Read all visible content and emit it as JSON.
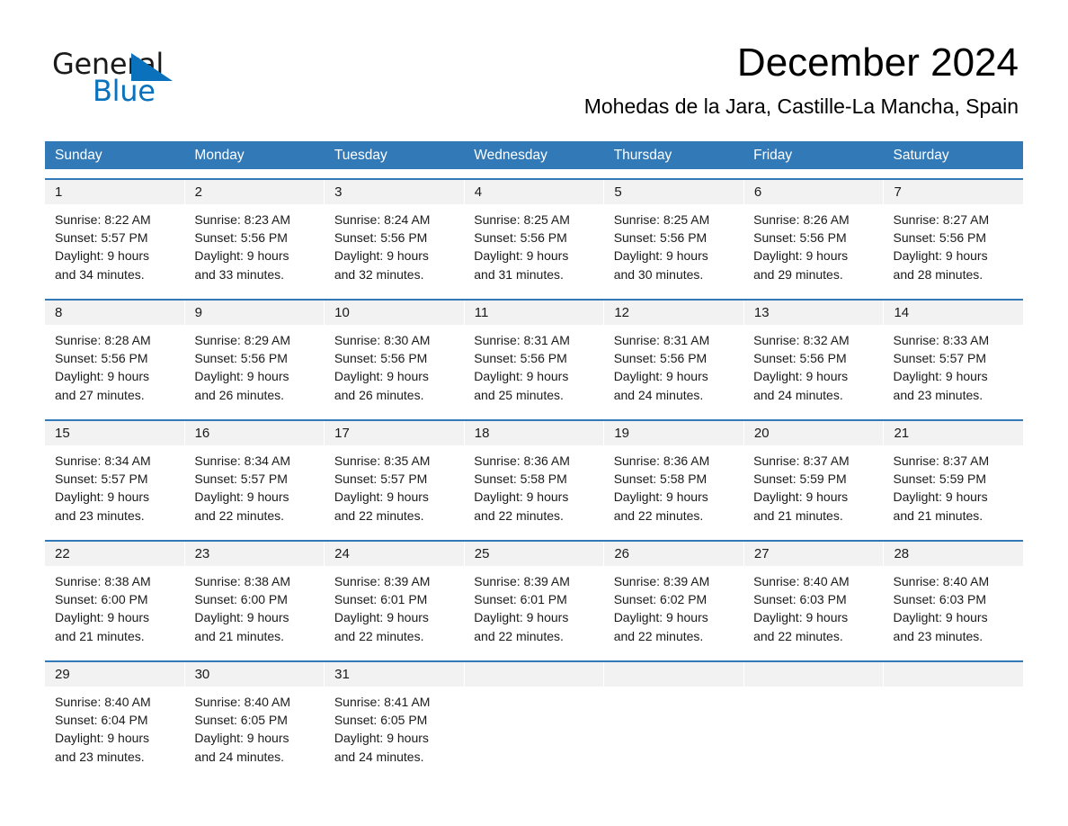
{
  "logo": {
    "word1": "General",
    "word2": "Blue",
    "triangle_color": "#0a72bd",
    "text_color": "#1a1a1a"
  },
  "header": {
    "title": "December 2024",
    "subtitle": "Mohedas de la Jara, Castille-La Mancha, Spain"
  },
  "theme": {
    "header_blue": "#3279b7",
    "daynum_gray": "#f2f2f2",
    "text": "#1a1a1a"
  },
  "weekdays": [
    "Sunday",
    "Monday",
    "Tuesday",
    "Wednesday",
    "Thursday",
    "Friday",
    "Saturday"
  ],
  "weeks": [
    {
      "daynums": [
        "1",
        "2",
        "3",
        "4",
        "5",
        "6",
        "7"
      ],
      "cells": [
        {
          "sunrise": "Sunrise: 8:22 AM",
          "sunset": "Sunset: 5:57 PM",
          "daylight1": "Daylight: 9 hours",
          "daylight2": "and 34 minutes."
        },
        {
          "sunrise": "Sunrise: 8:23 AM",
          "sunset": "Sunset: 5:56 PM",
          "daylight1": "Daylight: 9 hours",
          "daylight2": "and 33 minutes."
        },
        {
          "sunrise": "Sunrise: 8:24 AM",
          "sunset": "Sunset: 5:56 PM",
          "daylight1": "Daylight: 9 hours",
          "daylight2": "and 32 minutes."
        },
        {
          "sunrise": "Sunrise: 8:25 AM",
          "sunset": "Sunset: 5:56 PM",
          "daylight1": "Daylight: 9 hours",
          "daylight2": "and 31 minutes."
        },
        {
          "sunrise": "Sunrise: 8:25 AM",
          "sunset": "Sunset: 5:56 PM",
          "daylight1": "Daylight: 9 hours",
          "daylight2": "and 30 minutes."
        },
        {
          "sunrise": "Sunrise: 8:26 AM",
          "sunset": "Sunset: 5:56 PM",
          "daylight1": "Daylight: 9 hours",
          "daylight2": "and 29 minutes."
        },
        {
          "sunrise": "Sunrise: 8:27 AM",
          "sunset": "Sunset: 5:56 PM",
          "daylight1": "Daylight: 9 hours",
          "daylight2": "and 28 minutes."
        }
      ]
    },
    {
      "daynums": [
        "8",
        "9",
        "10",
        "11",
        "12",
        "13",
        "14"
      ],
      "cells": [
        {
          "sunrise": "Sunrise: 8:28 AM",
          "sunset": "Sunset: 5:56 PM",
          "daylight1": "Daylight: 9 hours",
          "daylight2": "and 27 minutes."
        },
        {
          "sunrise": "Sunrise: 8:29 AM",
          "sunset": "Sunset: 5:56 PM",
          "daylight1": "Daylight: 9 hours",
          "daylight2": "and 26 minutes."
        },
        {
          "sunrise": "Sunrise: 8:30 AM",
          "sunset": "Sunset: 5:56 PM",
          "daylight1": "Daylight: 9 hours",
          "daylight2": "and 26 minutes."
        },
        {
          "sunrise": "Sunrise: 8:31 AM",
          "sunset": "Sunset: 5:56 PM",
          "daylight1": "Daylight: 9 hours",
          "daylight2": "and 25 minutes."
        },
        {
          "sunrise": "Sunrise: 8:31 AM",
          "sunset": "Sunset: 5:56 PM",
          "daylight1": "Daylight: 9 hours",
          "daylight2": "and 24 minutes."
        },
        {
          "sunrise": "Sunrise: 8:32 AM",
          "sunset": "Sunset: 5:56 PM",
          "daylight1": "Daylight: 9 hours",
          "daylight2": "and 24 minutes."
        },
        {
          "sunrise": "Sunrise: 8:33 AM",
          "sunset": "Sunset: 5:57 PM",
          "daylight1": "Daylight: 9 hours",
          "daylight2": "and 23 minutes."
        }
      ]
    },
    {
      "daynums": [
        "15",
        "16",
        "17",
        "18",
        "19",
        "20",
        "21"
      ],
      "cells": [
        {
          "sunrise": "Sunrise: 8:34 AM",
          "sunset": "Sunset: 5:57 PM",
          "daylight1": "Daylight: 9 hours",
          "daylight2": "and 23 minutes."
        },
        {
          "sunrise": "Sunrise: 8:34 AM",
          "sunset": "Sunset: 5:57 PM",
          "daylight1": "Daylight: 9 hours",
          "daylight2": "and 22 minutes."
        },
        {
          "sunrise": "Sunrise: 8:35 AM",
          "sunset": "Sunset: 5:57 PM",
          "daylight1": "Daylight: 9 hours",
          "daylight2": "and 22 minutes."
        },
        {
          "sunrise": "Sunrise: 8:36 AM",
          "sunset": "Sunset: 5:58 PM",
          "daylight1": "Daylight: 9 hours",
          "daylight2": "and 22 minutes."
        },
        {
          "sunrise": "Sunrise: 8:36 AM",
          "sunset": "Sunset: 5:58 PM",
          "daylight1": "Daylight: 9 hours",
          "daylight2": "and 22 minutes."
        },
        {
          "sunrise": "Sunrise: 8:37 AM",
          "sunset": "Sunset: 5:59 PM",
          "daylight1": "Daylight: 9 hours",
          "daylight2": "and 21 minutes."
        },
        {
          "sunrise": "Sunrise: 8:37 AM",
          "sunset": "Sunset: 5:59 PM",
          "daylight1": "Daylight: 9 hours",
          "daylight2": "and 21 minutes."
        }
      ]
    },
    {
      "daynums": [
        "22",
        "23",
        "24",
        "25",
        "26",
        "27",
        "28"
      ],
      "cells": [
        {
          "sunrise": "Sunrise: 8:38 AM",
          "sunset": "Sunset: 6:00 PM",
          "daylight1": "Daylight: 9 hours",
          "daylight2": "and 21 minutes."
        },
        {
          "sunrise": "Sunrise: 8:38 AM",
          "sunset": "Sunset: 6:00 PM",
          "daylight1": "Daylight: 9 hours",
          "daylight2": "and 21 minutes."
        },
        {
          "sunrise": "Sunrise: 8:39 AM",
          "sunset": "Sunset: 6:01 PM",
          "daylight1": "Daylight: 9 hours",
          "daylight2": "and 22 minutes."
        },
        {
          "sunrise": "Sunrise: 8:39 AM",
          "sunset": "Sunset: 6:01 PM",
          "daylight1": "Daylight: 9 hours",
          "daylight2": "and 22 minutes."
        },
        {
          "sunrise": "Sunrise: 8:39 AM",
          "sunset": "Sunset: 6:02 PM",
          "daylight1": "Daylight: 9 hours",
          "daylight2": "and 22 minutes."
        },
        {
          "sunrise": "Sunrise: 8:40 AM",
          "sunset": "Sunset: 6:03 PM",
          "daylight1": "Daylight: 9 hours",
          "daylight2": "and 22 minutes."
        },
        {
          "sunrise": "Sunrise: 8:40 AM",
          "sunset": "Sunset: 6:03 PM",
          "daylight1": "Daylight: 9 hours",
          "daylight2": "and 23 minutes."
        }
      ]
    },
    {
      "daynums": [
        "29",
        "30",
        "31",
        "",
        "",
        "",
        ""
      ],
      "cells": [
        {
          "sunrise": "Sunrise: 8:40 AM",
          "sunset": "Sunset: 6:04 PM",
          "daylight1": "Daylight: 9 hours",
          "daylight2": "and 23 minutes."
        },
        {
          "sunrise": "Sunrise: 8:40 AM",
          "sunset": "Sunset: 6:05 PM",
          "daylight1": "Daylight: 9 hours",
          "daylight2": "and 24 minutes."
        },
        {
          "sunrise": "Sunrise: 8:41 AM",
          "sunset": "Sunset: 6:05 PM",
          "daylight1": "Daylight: 9 hours",
          "daylight2": "and 24 minutes."
        },
        {
          "sunrise": "",
          "sunset": "",
          "daylight1": "",
          "daylight2": ""
        },
        {
          "sunrise": "",
          "sunset": "",
          "daylight1": "",
          "daylight2": ""
        },
        {
          "sunrise": "",
          "sunset": "",
          "daylight1": "",
          "daylight2": ""
        },
        {
          "sunrise": "",
          "sunset": "",
          "daylight1": "",
          "daylight2": ""
        }
      ]
    }
  ]
}
